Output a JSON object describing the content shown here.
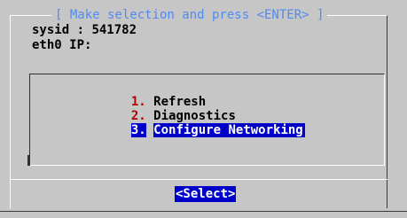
{
  "dialog": {
    "title": "[ Make selection and press <ENTER> ]",
    "sysid_label": "sysid",
    "sysid_sep": " : ",
    "sysid_value": "541782",
    "ip_label": "eth0 IP:"
  },
  "menu": {
    "items": [
      {
        "number": "1.",
        "label": "Refresh"
      },
      {
        "number": "2.",
        "label": "Diagnostics"
      },
      {
        "number": "3.",
        "label": "Configure Networking",
        "selected": true
      }
    ]
  },
  "buttons": {
    "select_label": "<Select>"
  },
  "colors": {
    "background": "#c6c6c6",
    "title": "#4f8bf0",
    "highlight": "#0000c8",
    "menu_number": "#b00000"
  }
}
